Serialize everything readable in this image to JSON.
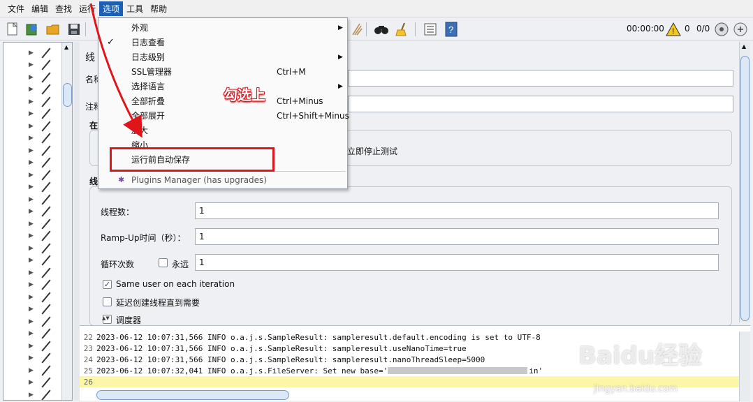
{
  "menubar": [
    "文件",
    "编辑",
    "查找",
    "运行",
    "选项",
    "工具",
    "帮助"
  ],
  "menubar_active_index": 4,
  "toolbar": {
    "timer": "00:00:00",
    "warning_count": "0",
    "thread_count": "0/0",
    "icons": [
      "new-file-icon",
      "templates-icon",
      "open-icon",
      "save-icon",
      "search-icon",
      "clear-icon",
      "function-list-icon",
      "help-icon",
      "warning-icon",
      "remote-icon"
    ]
  },
  "dropdown": {
    "items": [
      {
        "label": "外观",
        "shortcut": "",
        "submenu": true,
        "checked": false
      },
      {
        "label": "日志查看",
        "shortcut": "",
        "submenu": false,
        "checked": true
      },
      {
        "label": "日志级别",
        "shortcut": "",
        "submenu": true,
        "checked": false
      },
      {
        "label": "SSL管理器",
        "shortcut": "Ctrl+M",
        "submenu": false,
        "checked": false
      },
      {
        "label": "选择语言",
        "shortcut": "",
        "submenu": true,
        "checked": false
      },
      {
        "label": "全部折叠",
        "shortcut": "Ctrl+Minus",
        "submenu": false,
        "checked": false
      },
      {
        "label": "全部展开",
        "shortcut": "Ctrl+Shift+Minus",
        "submenu": false,
        "checked": false
      },
      {
        "label": "放大",
        "shortcut": "",
        "submenu": false,
        "checked": false
      },
      {
        "label": "缩小",
        "shortcut": "",
        "submenu": false,
        "checked": false
      },
      {
        "label": "运行前自动保存",
        "shortcut": "",
        "submenu": false,
        "checked": false
      }
    ],
    "plugins_label": "Plugins Manager (has upgrades)"
  },
  "annotation": "勾选上",
  "panel": {
    "title_partial": "线",
    "name_label_partial": "名称",
    "comment_label_partial": "注释",
    "on_error_partial": "在",
    "stop_test_now": "立即停止测试",
    "thread_props_partial": "线",
    "threads_label": "线程数：",
    "threads_value": "1",
    "rampup_label": "Ramp-Up时间（秒）：",
    "rampup_value": "1",
    "loop_label": "循环次数",
    "forever_label": "永远",
    "loop_value": "1",
    "same_user_label": "Same user on each iteration",
    "same_user_checked": true,
    "delay_label": "延迟创建线程直到需要",
    "scheduler_label": "调度器"
  },
  "log": [
    {
      "num": "22",
      "text": "2023-06-12 10:07:31,566 INFO o.a.j.s.SampleResult: sampleresult.default.encoding is set to UTF-8"
    },
    {
      "num": "23",
      "text": "2023-06-12 10:07:31,566 INFO o.a.j.s.SampleResult: sampleresult.useNanoTime=true"
    },
    {
      "num": "24",
      "text": "2023-06-12 10:07:31,566 INFO o.a.j.s.SampleResult: sampleresult.nanoThreadSleep=5000"
    },
    {
      "num": "25",
      "text_start": "2023-06-12 10:07:32,041 INFO o.a.j.s.FileServer: Set new base='",
      "text_end": "in'"
    },
    {
      "num": "26",
      "text": ""
    }
  ],
  "watermark": "Baidu经验",
  "watermark_sub": "jingyan.baidu.com"
}
